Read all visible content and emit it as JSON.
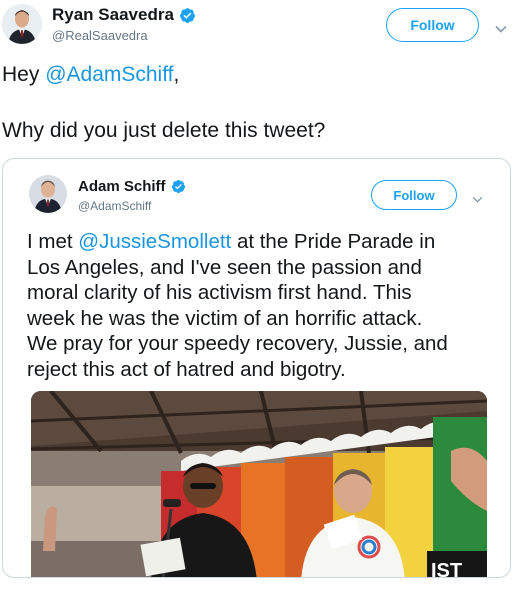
{
  "outer_tweet": {
    "author": {
      "display_name": "Ryan Saavedra",
      "handle": "@RealSaavedra",
      "verified_icon": "verified-badge-icon"
    },
    "follow_label": "Follow",
    "text": {
      "greeting_prefix": "Hey ",
      "greeting_mention": "@AdamSchiff",
      "greeting_suffix": ",",
      "question": "Why did you just delete this tweet?"
    }
  },
  "quoted_tweet": {
    "author": {
      "display_name": "Adam Schiff",
      "handle": "@AdamSchiff",
      "verified_icon": "verified-badge-icon"
    },
    "follow_label": "Follow",
    "text": {
      "line1_prefix": "I met ",
      "line1_mention": "@JussieSmollett",
      "line1_suffix": " at the Pride Parade in",
      "line2": "Los Angeles, and I've seen the passion and",
      "line3": "moral clarity of his activism first hand. This",
      "line4": "week he was the victim of an horrific attack.",
      "line5": "We pray for your speedy recovery, Jussie, and",
      "line6": "reject this act of hatred and bigotry."
    },
    "photo": {
      "banner_text": "IST"
    }
  },
  "colors": {
    "brand_blue": "#1da1f2",
    "mention_blue": "#1b95e0",
    "text_primary": "#14171a",
    "text_secondary": "#657786",
    "card_border": "#ccd6dd"
  },
  "icons": [
    "verified-badge-icon",
    "chevron-down-icon"
  ]
}
